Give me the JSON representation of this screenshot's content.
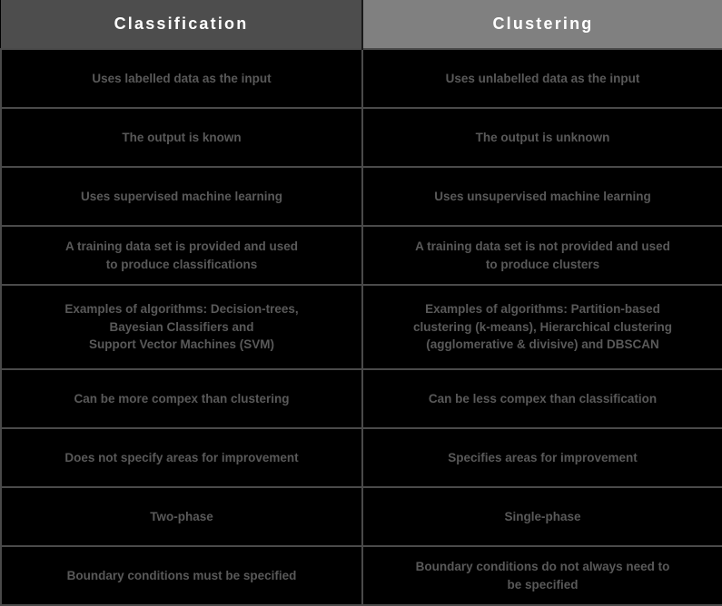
{
  "table": {
    "title": "Classification vs Clustering comparison table",
    "colors": {
      "header_left_bg": "#4d4d4d",
      "header_right_bg": "#808080",
      "header_text": "#ffffff",
      "body_bg": "#000000",
      "body_text": "#595959",
      "grid_line": "#4a4a4a"
    },
    "headers": [
      {
        "label": "Classification"
      },
      {
        "label": "Clustering"
      }
    ],
    "rows": [
      {
        "height": "standard",
        "left": [
          "Uses labelled data as the input"
        ],
        "right": [
          "Uses unlabelled data as the input"
        ]
      },
      {
        "height": "standard",
        "left": [
          "The output is known"
        ],
        "right": [
          "The output is unknown"
        ]
      },
      {
        "height": "standard",
        "left": [
          "Uses supervised machine learning"
        ],
        "right": [
          "Uses unsupervised machine learning"
        ]
      },
      {
        "height": "standard",
        "left": [
          "A training data set is provided and used",
          "to produce classifications"
        ],
        "right": [
          "A training data set is not provided and used",
          "to produce clusters"
        ]
      },
      {
        "height": "tall",
        "left": [
          "Examples of algorithms: Decision-trees,",
          "Bayesian Classifiers and",
          "Support Vector Machines (SVM)"
        ],
        "right": [
          "Examples of algorithms: Partition-based",
          "clustering (k-means), Hierarchical clustering",
          "(agglomerative & divisive) and DBSCAN"
        ]
      },
      {
        "height": "standard",
        "left": [
          "Can be more compex than clustering"
        ],
        "right": [
          "Can be less compex than classification"
        ]
      },
      {
        "height": "standard",
        "left": [
          "Does not specify areas for improvement"
        ],
        "right": [
          "Specifies areas for improvement"
        ]
      },
      {
        "height": "standard",
        "left": [
          "Two-phase"
        ],
        "right": [
          "Single-phase"
        ]
      },
      {
        "height": "standard",
        "left": [
          "Boundary conditions must be specified"
        ],
        "right": [
          "Boundary conditions do not always need to",
          "be specified"
        ]
      }
    ]
  }
}
